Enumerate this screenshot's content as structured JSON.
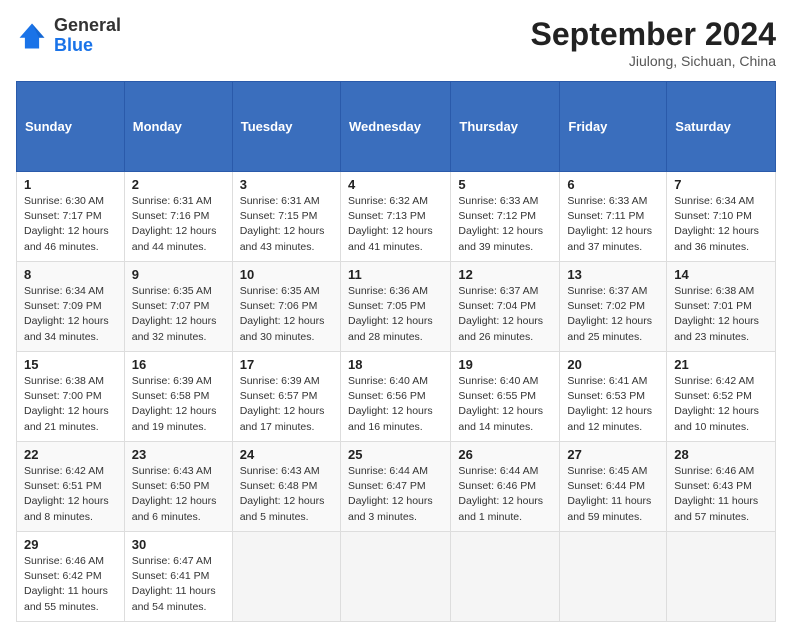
{
  "header": {
    "logo_general": "General",
    "logo_blue": "Blue",
    "month_year": "September 2024",
    "location": "Jiulong, Sichuan, China"
  },
  "columns": [
    "Sunday",
    "Monday",
    "Tuesday",
    "Wednesday",
    "Thursday",
    "Friday",
    "Saturday"
  ],
  "weeks": [
    [
      {
        "day": "1",
        "lines": [
          "Sunrise: 6:30 AM",
          "Sunset: 7:17 PM",
          "Daylight: 12 hours",
          "and 46 minutes."
        ]
      },
      {
        "day": "2",
        "lines": [
          "Sunrise: 6:31 AM",
          "Sunset: 7:16 PM",
          "Daylight: 12 hours",
          "and 44 minutes."
        ]
      },
      {
        "day": "3",
        "lines": [
          "Sunrise: 6:31 AM",
          "Sunset: 7:15 PM",
          "Daylight: 12 hours",
          "and 43 minutes."
        ]
      },
      {
        "day": "4",
        "lines": [
          "Sunrise: 6:32 AM",
          "Sunset: 7:13 PM",
          "Daylight: 12 hours",
          "and 41 minutes."
        ]
      },
      {
        "day": "5",
        "lines": [
          "Sunrise: 6:33 AM",
          "Sunset: 7:12 PM",
          "Daylight: 12 hours",
          "and 39 minutes."
        ]
      },
      {
        "day": "6",
        "lines": [
          "Sunrise: 6:33 AM",
          "Sunset: 7:11 PM",
          "Daylight: 12 hours",
          "and 37 minutes."
        ]
      },
      {
        "day": "7",
        "lines": [
          "Sunrise: 6:34 AM",
          "Sunset: 7:10 PM",
          "Daylight: 12 hours",
          "and 36 minutes."
        ]
      }
    ],
    [
      {
        "day": "8",
        "lines": [
          "Sunrise: 6:34 AM",
          "Sunset: 7:09 PM",
          "Daylight: 12 hours",
          "and 34 minutes."
        ]
      },
      {
        "day": "9",
        "lines": [
          "Sunrise: 6:35 AM",
          "Sunset: 7:07 PM",
          "Daylight: 12 hours",
          "and 32 minutes."
        ]
      },
      {
        "day": "10",
        "lines": [
          "Sunrise: 6:35 AM",
          "Sunset: 7:06 PM",
          "Daylight: 12 hours",
          "and 30 minutes."
        ]
      },
      {
        "day": "11",
        "lines": [
          "Sunrise: 6:36 AM",
          "Sunset: 7:05 PM",
          "Daylight: 12 hours",
          "and 28 minutes."
        ]
      },
      {
        "day": "12",
        "lines": [
          "Sunrise: 6:37 AM",
          "Sunset: 7:04 PM",
          "Daylight: 12 hours",
          "and 26 minutes."
        ]
      },
      {
        "day": "13",
        "lines": [
          "Sunrise: 6:37 AM",
          "Sunset: 7:02 PM",
          "Daylight: 12 hours",
          "and 25 minutes."
        ]
      },
      {
        "day": "14",
        "lines": [
          "Sunrise: 6:38 AM",
          "Sunset: 7:01 PM",
          "Daylight: 12 hours",
          "and 23 minutes."
        ]
      }
    ],
    [
      {
        "day": "15",
        "lines": [
          "Sunrise: 6:38 AM",
          "Sunset: 7:00 PM",
          "Daylight: 12 hours",
          "and 21 minutes."
        ]
      },
      {
        "day": "16",
        "lines": [
          "Sunrise: 6:39 AM",
          "Sunset: 6:58 PM",
          "Daylight: 12 hours",
          "and 19 minutes."
        ]
      },
      {
        "day": "17",
        "lines": [
          "Sunrise: 6:39 AM",
          "Sunset: 6:57 PM",
          "Daylight: 12 hours",
          "and 17 minutes."
        ]
      },
      {
        "day": "18",
        "lines": [
          "Sunrise: 6:40 AM",
          "Sunset: 6:56 PM",
          "Daylight: 12 hours",
          "and 16 minutes."
        ]
      },
      {
        "day": "19",
        "lines": [
          "Sunrise: 6:40 AM",
          "Sunset: 6:55 PM",
          "Daylight: 12 hours",
          "and 14 minutes."
        ]
      },
      {
        "day": "20",
        "lines": [
          "Sunrise: 6:41 AM",
          "Sunset: 6:53 PM",
          "Daylight: 12 hours",
          "and 12 minutes."
        ]
      },
      {
        "day": "21",
        "lines": [
          "Sunrise: 6:42 AM",
          "Sunset: 6:52 PM",
          "Daylight: 12 hours",
          "and 10 minutes."
        ]
      }
    ],
    [
      {
        "day": "22",
        "lines": [
          "Sunrise: 6:42 AM",
          "Sunset: 6:51 PM",
          "Daylight: 12 hours",
          "and 8 minutes."
        ]
      },
      {
        "day": "23",
        "lines": [
          "Sunrise: 6:43 AM",
          "Sunset: 6:50 PM",
          "Daylight: 12 hours",
          "and 6 minutes."
        ]
      },
      {
        "day": "24",
        "lines": [
          "Sunrise: 6:43 AM",
          "Sunset: 6:48 PM",
          "Daylight: 12 hours",
          "and 5 minutes."
        ]
      },
      {
        "day": "25",
        "lines": [
          "Sunrise: 6:44 AM",
          "Sunset: 6:47 PM",
          "Daylight: 12 hours",
          "and 3 minutes."
        ]
      },
      {
        "day": "26",
        "lines": [
          "Sunrise: 6:44 AM",
          "Sunset: 6:46 PM",
          "Daylight: 12 hours",
          "and 1 minute."
        ]
      },
      {
        "day": "27",
        "lines": [
          "Sunrise: 6:45 AM",
          "Sunset: 6:44 PM",
          "Daylight: 11 hours",
          "and 59 minutes."
        ]
      },
      {
        "day": "28",
        "lines": [
          "Sunrise: 6:46 AM",
          "Sunset: 6:43 PM",
          "Daylight: 11 hours",
          "and 57 minutes."
        ]
      }
    ],
    [
      {
        "day": "29",
        "lines": [
          "Sunrise: 6:46 AM",
          "Sunset: 6:42 PM",
          "Daylight: 11 hours",
          "and 55 minutes."
        ]
      },
      {
        "day": "30",
        "lines": [
          "Sunrise: 6:47 AM",
          "Sunset: 6:41 PM",
          "Daylight: 11 hours",
          "and 54 minutes."
        ]
      },
      null,
      null,
      null,
      null,
      null
    ]
  ]
}
